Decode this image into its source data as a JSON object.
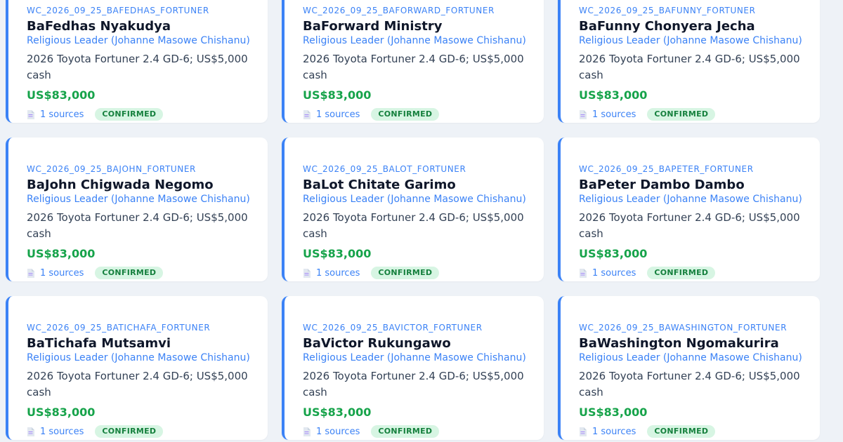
{
  "cards": [
    {
      "id": "WC_2026_09_25_BAFEDHAS_FORTUNER",
      "name": "BaFedhas Nyakudya",
      "role": "Religious Leader (Johanne Masowe Chishanu)",
      "description": "2026 Toyota Fortuner 2.4 GD-6; US$5,000 cash",
      "amount": "US$83,000",
      "sources": "1 sources",
      "status": "CONFIRMED"
    },
    {
      "id": "WC_2026_09_25_BAFORWARD_FORTUNER",
      "name": "BaForward Ministry",
      "role": "Religious Leader (Johanne Masowe Chishanu)",
      "description": "2026 Toyota Fortuner 2.4 GD-6; US$5,000 cash",
      "amount": "US$83,000",
      "sources": "1 sources",
      "status": "CONFIRMED"
    },
    {
      "id": "WC_2026_09_25_BAFUNNY_FORTUNER",
      "name": "BaFunny Chonyera Jecha",
      "role": "Religious Leader (Johanne Masowe Chishanu)",
      "description": "2026 Toyota Fortuner 2.4 GD-6; US$5,000 cash",
      "amount": "US$83,000",
      "sources": "1 sources",
      "status": "CONFIRMED"
    },
    {
      "id": "WC_2026_09_25_BAJOHN_FORTUNER",
      "name": "BaJohn Chigwada Negomo",
      "role": "Religious Leader (Johanne Masowe Chishanu)",
      "description": "2026 Toyota Fortuner 2.4 GD-6; US$5,000 cash",
      "amount": "US$83,000",
      "sources": "1 sources",
      "status": "CONFIRMED"
    },
    {
      "id": "WC_2026_09_25_BALOT_FORTUNER",
      "name": "BaLot Chitate Garimo",
      "role": "Religious Leader (Johanne Masowe Chishanu)",
      "description": "2026 Toyota Fortuner 2.4 GD-6; US$5,000 cash",
      "amount": "US$83,000",
      "sources": "1 sources",
      "status": "CONFIRMED"
    },
    {
      "id": "WC_2026_09_25_BAPETER_FORTUNER",
      "name": "BaPeter Dambo Dambo",
      "role": "Religious Leader (Johanne Masowe Chishanu)",
      "description": "2026 Toyota Fortuner 2.4 GD-6; US$5,000 cash",
      "amount": "US$83,000",
      "sources": "1 sources",
      "status": "CONFIRMED"
    },
    {
      "id": "WC_2026_09_25_BATICHAFA_FORTUNER",
      "name": "BaTichafa Mutsamvi",
      "role": "Religious Leader (Johanne Masowe Chishanu)",
      "description": "2026 Toyota Fortuner 2.4 GD-6; US$5,000 cash",
      "amount": "US$83,000",
      "sources": "1 sources",
      "status": "CONFIRMED"
    },
    {
      "id": "WC_2026_09_25_BAVICTOR_FORTUNER",
      "name": "BaVictor Rukungawo",
      "role": "Religious Leader (Johanne Masowe Chishanu)",
      "description": "2026 Toyota Fortuner 2.4 GD-6; US$5,000 cash",
      "amount": "US$83,000",
      "sources": "1 sources",
      "status": "CONFIRMED"
    },
    {
      "id": "WC_2026_09_25_BAWASHINGTON_FORTUNER",
      "name": "BaWashington Ngomakurira",
      "role": "Religious Leader (Johanne Masowe Chishanu)",
      "description": "2026 Toyota Fortuner 2.4 GD-6; US$5,000 cash",
      "amount": "US$83,000",
      "sources": "1 sources",
      "status": "CONFIRMED"
    }
  ],
  "icons": {
    "sources": "document-icon"
  },
  "colors": {
    "accent": "#3b82f6",
    "amount": "#16a34a",
    "badge_bg": "#d7f5e3",
    "badge_text": "#15803d"
  }
}
